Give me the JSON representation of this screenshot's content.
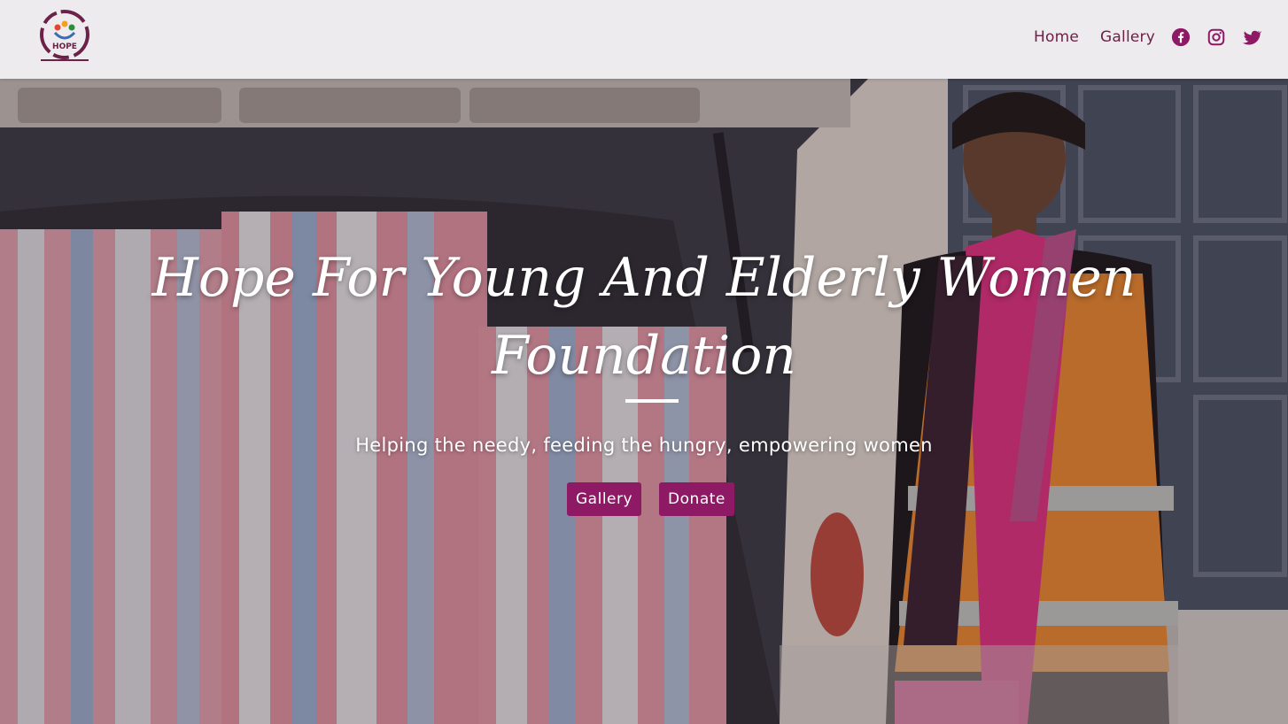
{
  "header": {
    "logo_text": "HOPE",
    "nav": [
      {
        "label": "Home"
      },
      {
        "label": "Gallery"
      }
    ],
    "social_icons": [
      "facebook-icon",
      "instagram-icon",
      "twitter-icon"
    ],
    "accent_color": "#6b2148"
  },
  "hero": {
    "title_line1": "Hope For Young And Elderly Women",
    "title_line2": "Foundation",
    "subtitle": "Helping the needy, feeding the hungry, empowering women",
    "buttons": {
      "gallery": "Gallery",
      "donate": "Donate"
    },
    "button_color": "#8e1a66"
  }
}
